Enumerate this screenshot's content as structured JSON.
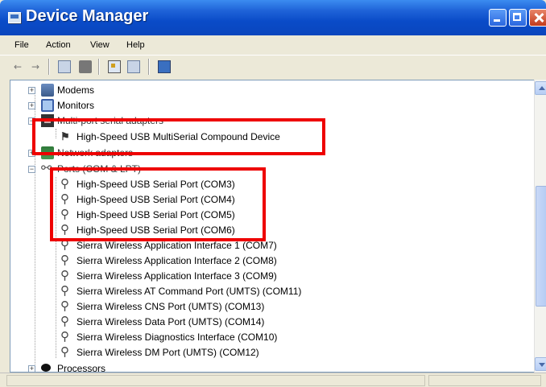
{
  "window": {
    "title": "Device Manager",
    "controls": [
      "minimize",
      "maximize",
      "close"
    ]
  },
  "menubar": {
    "items": [
      "File",
      "Action",
      "View",
      "Help"
    ]
  },
  "toolbar": {
    "back_icon": "arrow-left-icon",
    "forward_icon": "arrow-right-icon",
    "tools": [
      "show-hide-console-tree-icon",
      "print-icon",
      "properties-icon",
      "help-icon",
      "scan-hardware-icon"
    ]
  },
  "tree": {
    "modems": "Modems",
    "monitors": "Monitors",
    "multiport": "Multi-port serial adapters",
    "multiport_child": "High-Speed USB MultiSerial Compound Device",
    "network": "Network adapters",
    "ports": "Ports (COM & LPT)",
    "port_items": [
      "High-Speed USB Serial Port (COM3)",
      "High-Speed USB Serial Port (COM4)",
      "High-Speed USB Serial Port (COM5)",
      "High-Speed USB Serial Port (COM6)",
      "Sierra Wireless Application Interface 1 (COM7)",
      "Sierra Wireless Application Interface 2 (COM8)",
      "Sierra Wireless Application Interface 3 (COM9)",
      "Sierra Wireless AT Command Port (UMTS) (COM11)",
      "Sierra Wireless CNS Port (UMTS) (COM13)",
      "Sierra Wireless Data Port (UMTS) (COM14)",
      "Sierra Wireless Diagnostics Interface (COM10)",
      "Sierra Wireless DM Port (UMTS) (COM12)"
    ],
    "processors": "Processors"
  },
  "colors": {
    "titlebar": "#0a4bc8",
    "highlight": "#ee0000",
    "window_bg": "#ece9d8"
  }
}
